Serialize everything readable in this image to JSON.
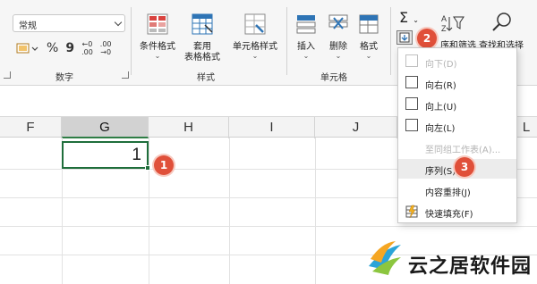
{
  "ribbon": {
    "number_group": {
      "format_value": "常规",
      "label": "数字",
      "percent_symbol": "%",
      "comma_symbol": "9",
      "increase_decimal_top": "←0",
      "increase_decimal_bottom": ".00",
      "decrease_decimal_top": ".00",
      "decrease_decimal_bottom": "→0"
    },
    "styles_group": {
      "label": "样式",
      "conditional_format": "条件格式",
      "table_format_line1": "套用",
      "table_format_line2": "表格格式",
      "cell_style": "单元格样式"
    },
    "cells_group": {
      "label": "单元格",
      "insert": "插入",
      "delete": "删除",
      "format": "格式"
    },
    "editing_group": {
      "sigma": "Σ",
      "sort_filter": "序和筛选",
      "find_select": "查找和选择"
    }
  },
  "sheet": {
    "columns": [
      "F",
      "G",
      "H",
      "I",
      "J",
      "L"
    ],
    "selected_column": "G",
    "active_cell_value": "1"
  },
  "fill_menu": {
    "items": [
      {
        "label": "向下(D)",
        "disabled": true
      },
      {
        "label": "向右(R)",
        "disabled": false
      },
      {
        "label": "向上(U)",
        "disabled": false
      },
      {
        "label": "向左(L)",
        "disabled": false
      },
      {
        "label": "至同组工作表(A)...",
        "disabled": true
      },
      {
        "label": "序列(S)...",
        "disabled": false
      },
      {
        "label": "内容重排(J)",
        "disabled": false
      },
      {
        "label": "快速填充(F)",
        "disabled": false
      }
    ]
  },
  "badges": {
    "one": "1",
    "two": "2",
    "three": "3"
  },
  "watermark": {
    "text": "云之居软件园"
  },
  "colors": {
    "badge": "#e0503a",
    "selection_green": "#1f6e3b",
    "ribbon_bg": "#f6f6f6"
  }
}
